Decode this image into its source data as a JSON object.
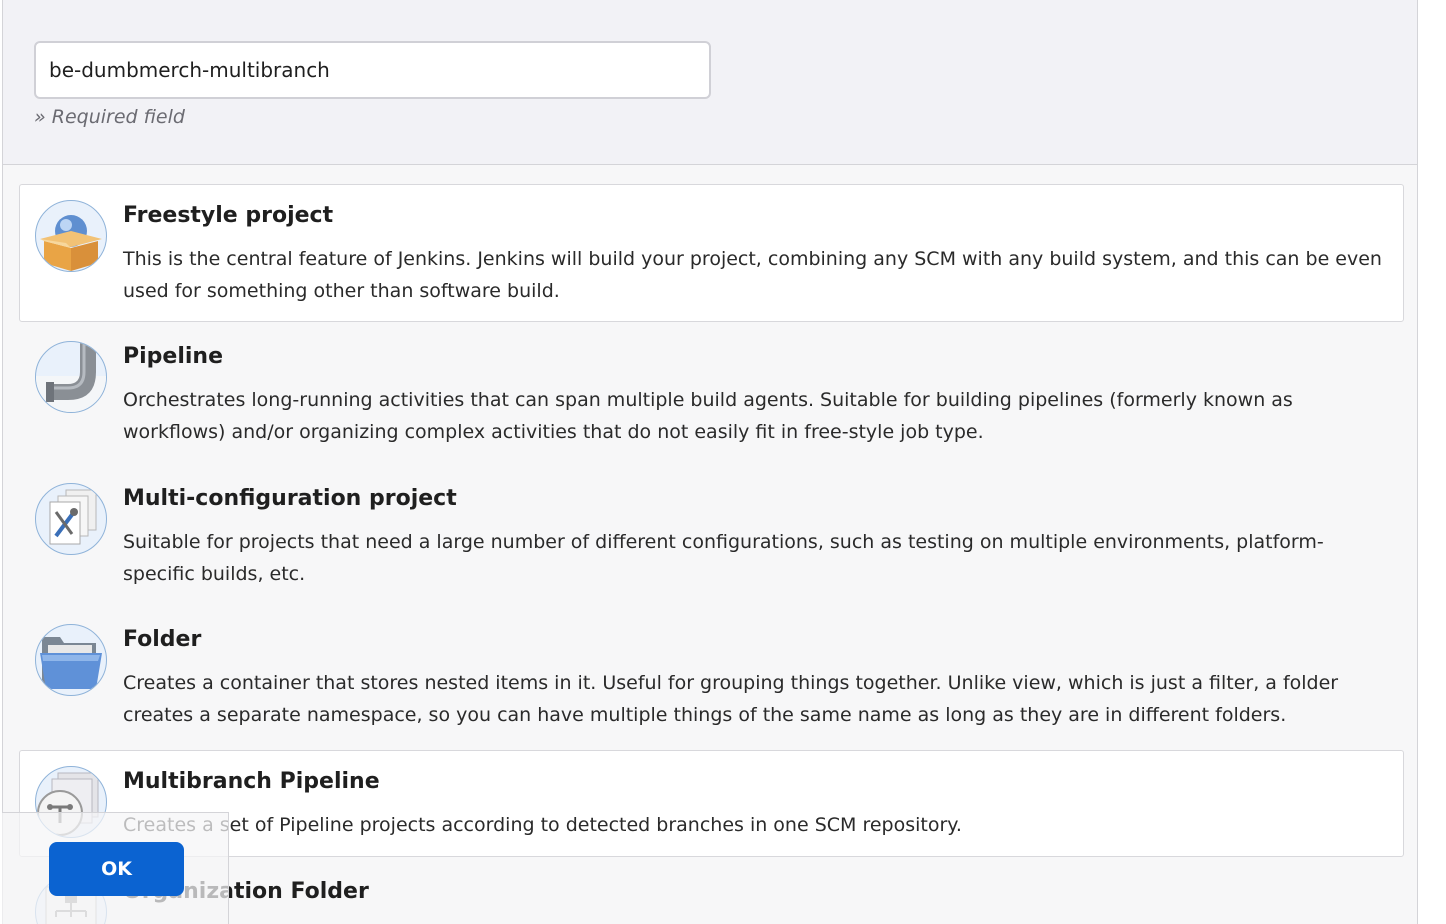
{
  "name_field": {
    "value": "be-dumbmerch-multibranch",
    "required_note": "» Required field"
  },
  "items": [
    {
      "title": "Freestyle project",
      "description": "This is the central feature of Jenkins. Jenkins will build your project, combining any SCM with any build system, and this can be even used for something other than software build.",
      "icon": "freestyle-box-icon"
    },
    {
      "title": "Pipeline",
      "description": "Orchestrates long-running activities that can span multiple build agents. Suitable for building pipelines (formerly known as workflows) and/or organizing complex activities that do not easily fit in free-style job type.",
      "icon": "pipe-icon"
    },
    {
      "title": "Multi-configuration project",
      "description": "Suitable for projects that need a large number of different configurations, such as testing on multiple environments, platform-specific builds, etc.",
      "icon": "multi-config-tools-icon"
    },
    {
      "title": "Folder",
      "description": "Creates a container that stores nested items in it. Useful for grouping things together. Unlike view, which is just a filter, a folder creates a separate namespace, so you can have multiple things of the same name as long as they are in different folders.",
      "icon": "folder-icon"
    },
    {
      "title": "Multibranch Pipeline",
      "description": "Creates a set of Pipeline projects according to detected branches in one SCM repository.",
      "icon": "multibranch-icon",
      "selected": true
    },
    {
      "title": "Organization Folder",
      "description": "",
      "icon": "organization-folder-icon"
    }
  ],
  "ok_button": {
    "label": "OK"
  },
  "colors": {
    "ok_button": "#0b63d1",
    "selected_item_bg": "#ffffff",
    "page_bg": "#f7f7f8"
  }
}
